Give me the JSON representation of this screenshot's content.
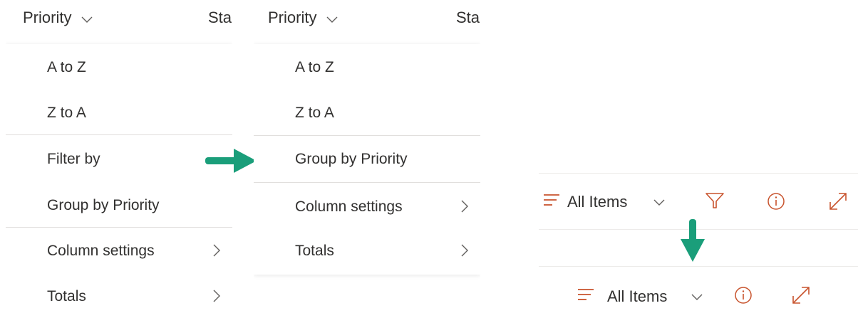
{
  "left_panel": {
    "header": {
      "title": "Priority",
      "next_column": "Sta"
    },
    "menu_items": [
      {
        "label": "A to Z",
        "has_submenu": false
      },
      {
        "label": "Z to A",
        "has_submenu": false
      },
      {
        "label": "Filter by",
        "has_submenu": false
      },
      {
        "label": "Group by Priority",
        "has_submenu": false
      },
      {
        "label": "Column settings",
        "has_submenu": true
      },
      {
        "label": "Totals",
        "has_submenu": true
      }
    ]
  },
  "middle_panel": {
    "header": {
      "title": "Priority",
      "next_column": "Sta"
    },
    "menu_items": [
      {
        "label": "A to Z",
        "has_submenu": false
      },
      {
        "label": "Z to A",
        "has_submenu": false
      },
      {
        "label": "Group by Priority",
        "has_submenu": false
      },
      {
        "label": "Column settings",
        "has_submenu": true
      },
      {
        "label": "Totals",
        "has_submenu": true
      }
    ]
  },
  "command_bar_before": {
    "view_label": "All Items",
    "icons": [
      "lines-icon",
      "chevron-down-icon",
      "filter-icon",
      "info-icon",
      "expand-icon"
    ]
  },
  "command_bar_after": {
    "view_label": "All Items",
    "icons": [
      "lines-icon",
      "chevron-down-icon",
      "info-icon",
      "expand-icon"
    ]
  },
  "colors": {
    "accent": "#c8532d",
    "arrow": "#1a9e7a",
    "text": "#323130",
    "separator": "#e1dfdd"
  }
}
